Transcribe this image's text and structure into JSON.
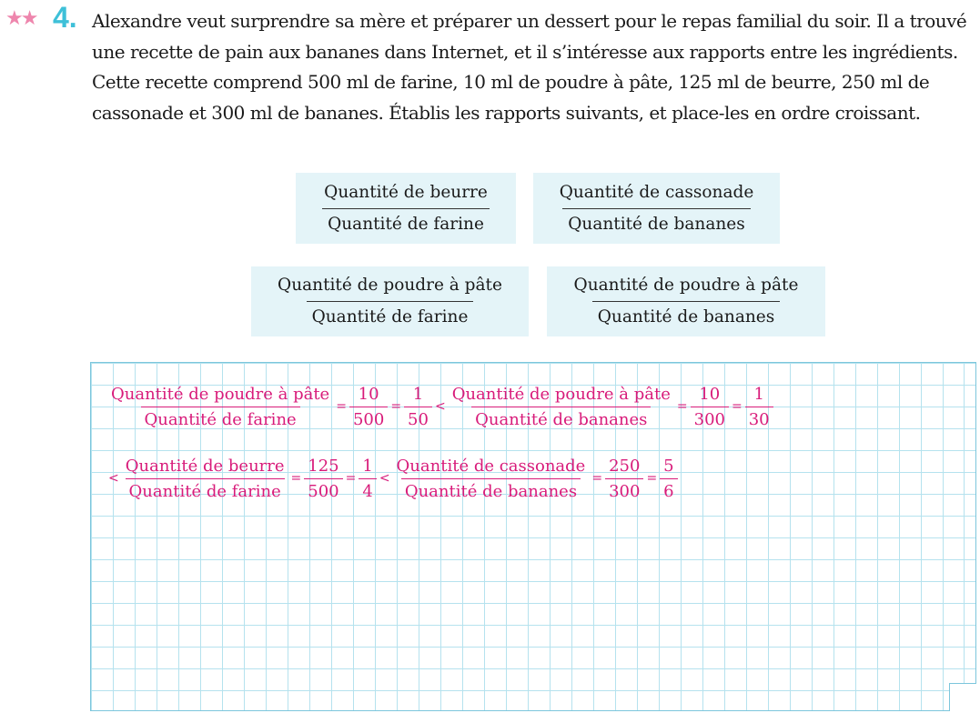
{
  "problem": {
    "stars": "★★",
    "number": "4.",
    "text": "Alexandre veut surprendre sa mère et préparer un dessert pour le repas familial du soir. Il a trouvé une recette de pain aux bananes dans Internet, et il s’intéresse aux rapports entre les ingrédients. Cette recette comprend 500 ml de farine, 10 ml de poudre à pâte, 125 ml de beurre, 250 ml de cassonade et 300 ml de bananes. Établis les rapports suivants, et place-les en ordre croissant."
  },
  "ratios": [
    {
      "num": "Quantité de beurre",
      "den": "Quantité de farine"
    },
    {
      "num": "Quantité de cassonade",
      "den": "Quantité de bananes"
    },
    {
      "num": "Quantité de poudre à pâte",
      "den": "Quantité de farine"
    },
    {
      "num": "Quantité de poudre à pâte",
      "den": "Quantité de bananes"
    }
  ],
  "answer": {
    "lt": "<",
    "eq": "=",
    "line1": [
      {
        "num": "Quantité de poudre à pâte",
        "den": "Quantité de farine",
        "v1n": "10",
        "v1d": "500",
        "v2n": "1",
        "v2d": "50"
      },
      {
        "num": "Quantité de poudre à pâte",
        "den": "Quantité de bananes",
        "v1n": "10",
        "v1d": "300",
        "v2n": "1",
        "v2d": "30"
      }
    ],
    "line2": [
      {
        "num": "Quantité de beurre",
        "den": "Quantité de farine",
        "v1n": "125",
        "v1d": "500",
        "v2n": "1",
        "v2d": "4"
      },
      {
        "num": "Quantité de cassonade",
        "den": "Quantité de bananes",
        "v1n": "250",
        "v1d": "300",
        "v2n": "5",
        "v2d": "6"
      }
    ]
  },
  "colors": {
    "accent_blue": "#3ec0d8",
    "star_pink": "#ee86ad",
    "answer_magenta": "#d81b7a",
    "box_bg": "#e4f4f8",
    "grid_line": "#b5e2ee"
  }
}
